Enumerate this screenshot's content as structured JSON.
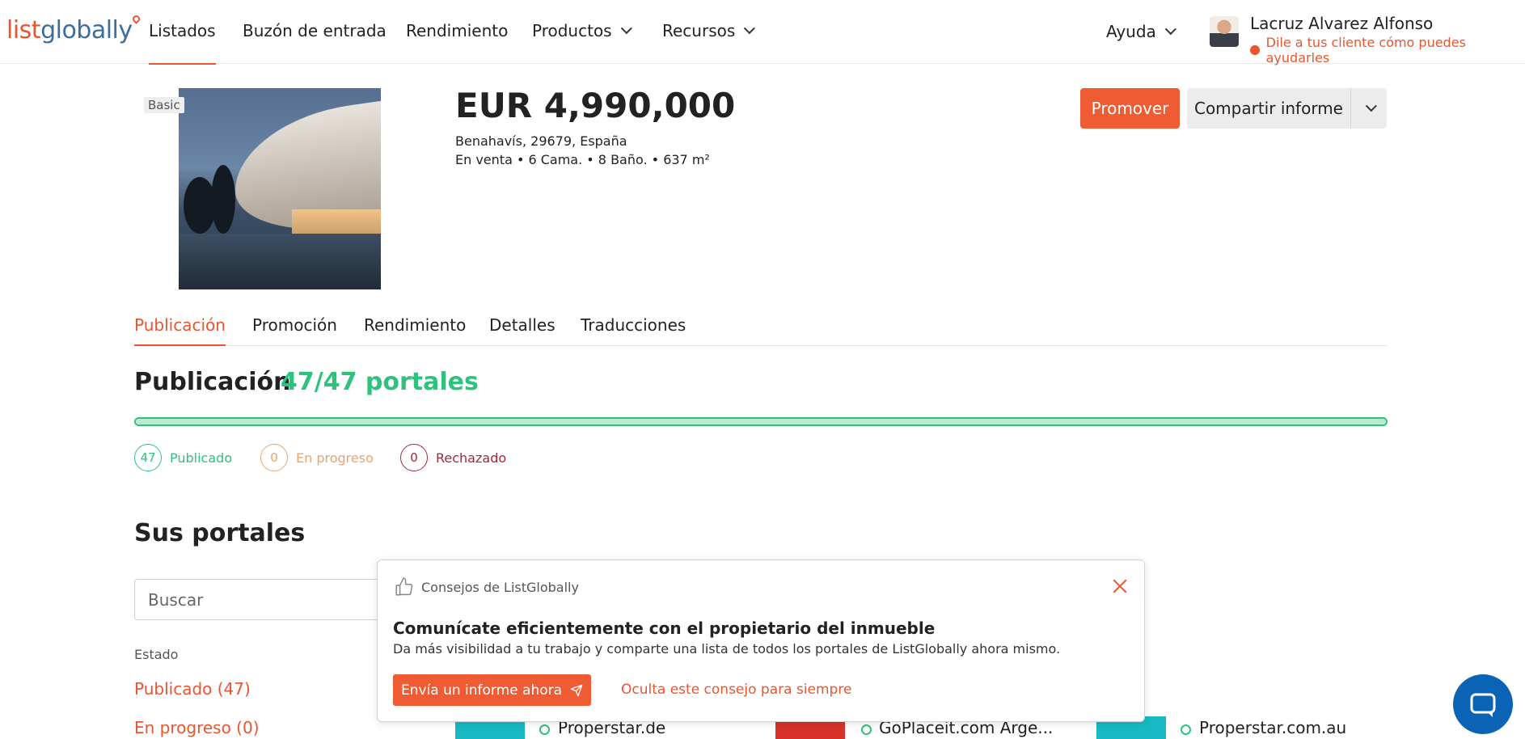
{
  "brand": {
    "logo_part1": "list",
    "logo_part2": "globally",
    "accent": "#e8552e",
    "success": "#2ec27e"
  },
  "nav": {
    "items": [
      {
        "label": "Listados",
        "active": true
      },
      {
        "label": "Buzón de entrada"
      },
      {
        "label": "Rendimiento"
      },
      {
        "label": "Productos",
        "has_dropdown": true
      },
      {
        "label": "Recursos",
        "has_dropdown": true
      }
    ],
    "help_label": "Ayuda"
  },
  "user": {
    "name": "Lacruz Alvarez Alfonso",
    "tip": "Dile a tus cliente cómo puedes ayudarles"
  },
  "property": {
    "badge": "Basic",
    "price": "EUR 4,990,000",
    "address": "Benahavís, 29679, España",
    "specs": "En venta • 6 Cama. • 8 Baño. • 637 m²"
  },
  "actions": {
    "promote_label": "Promover",
    "share_label": "Compartir informe"
  },
  "tabs": [
    {
      "label": "Publicación",
      "active": true
    },
    {
      "label": "Promoción"
    },
    {
      "label": "Rendimiento"
    },
    {
      "label": "Detalles"
    },
    {
      "label": "Traducciones"
    }
  ],
  "publication": {
    "title": "Publicación",
    "count_label": "47/47 portales",
    "progress": 1.0,
    "stats": [
      {
        "count": "47",
        "label": "Publicado",
        "color": "#2ec27e"
      },
      {
        "count": "0",
        "label": "En progreso",
        "color": "#e9a36c"
      },
      {
        "count": "0",
        "label": "Rechazado",
        "color": "#a3283c"
      }
    ]
  },
  "portals": {
    "title": "Sus portales",
    "search_placeholder": "Buscar",
    "estado_label": "Estado",
    "filters": [
      "Publicado (47)",
      "En progreso (0)"
    ],
    "items": [
      {
        "name": "Properstar.de",
        "logo_color": "#18b9c4"
      },
      {
        "name": "GoPlaceit.com Arge...",
        "logo_color": "#d9322b"
      },
      {
        "name": "Properstar.com.au",
        "logo_color": "#18b9c4"
      }
    ]
  },
  "tip": {
    "header": "Consejos de ListGlobally",
    "title": "Comunícate eficientemente con el propietario del inmueble",
    "text": "Da más visibilidad a tu trabajo y comparte una lista de todos los portales de ListGlobally ahora mismo.",
    "button_label": "Envía un informe ahora",
    "dismiss_label": "Oculta este consejo para siempre"
  },
  "icons": {
    "chat": "chat-icon",
    "thumbs_up": "thumbs-up-icon",
    "send": "send-icon",
    "close": "close-icon"
  }
}
